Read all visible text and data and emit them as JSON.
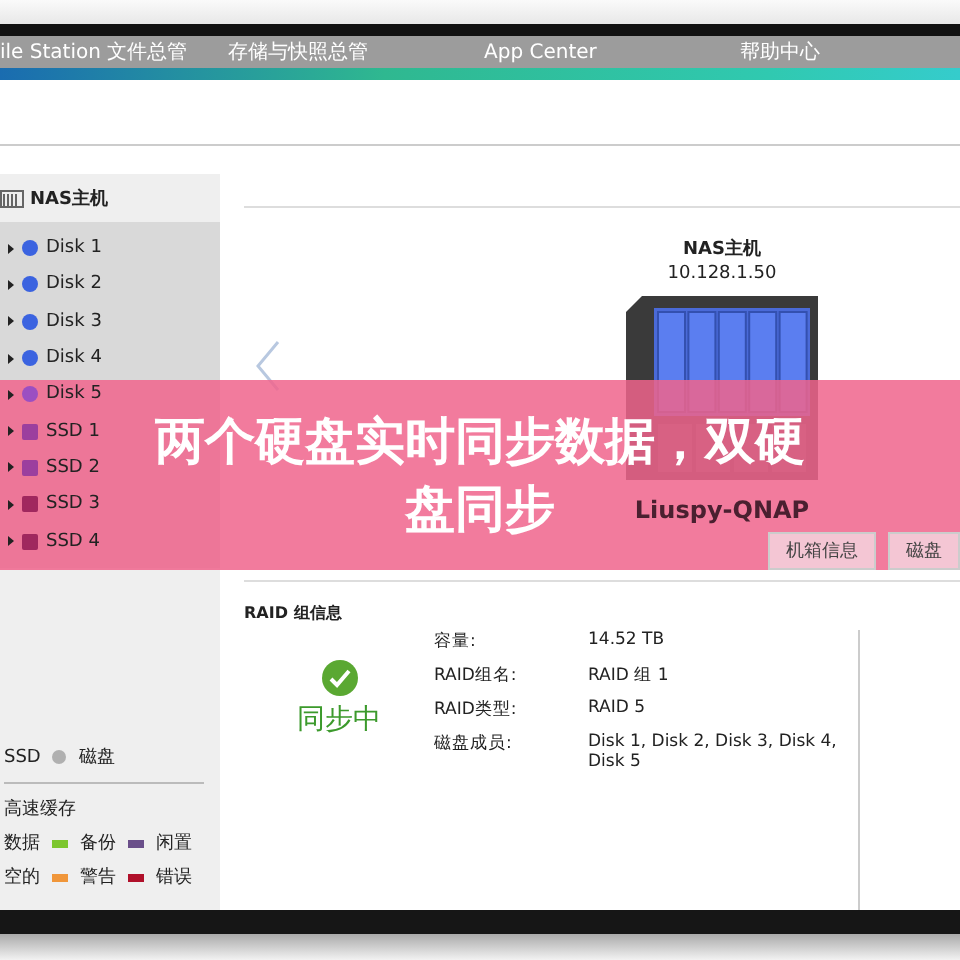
{
  "top_tabs": [
    "ile Station 文件总管",
    "存储与快照总管",
    "App Center",
    "帮助中心"
  ],
  "sidebar": {
    "root": "NAS主机",
    "items": [
      {
        "label": "Disk 1",
        "kind": "disk",
        "color": "#3b63e0"
      },
      {
        "label": "Disk 2",
        "kind": "disk",
        "color": "#3b63e0"
      },
      {
        "label": "Disk 3",
        "kind": "disk",
        "color": "#3b63e0"
      },
      {
        "label": "Disk 4",
        "kind": "disk",
        "color": "#3b63e0"
      },
      {
        "label": "Disk 5",
        "kind": "disk",
        "color": "#9b4fc2"
      },
      {
        "label": "SSD 1",
        "kind": "ssd",
        "color": "#9c3f9e"
      },
      {
        "label": "SSD 2",
        "kind": "ssd",
        "color": "#9c3f9e"
      },
      {
        "label": "SSD 3",
        "kind": "ssd",
        "color": "#a0285e"
      },
      {
        "label": "SSD 4",
        "kind": "ssd",
        "color": "#a0285e"
      }
    ],
    "type_legend": [
      {
        "label": "SSD"
      },
      {
        "label": "磁盘",
        "color": "#b0b0b0"
      }
    ],
    "status_title": "高速缓存",
    "status_legend": [
      [
        {
          "label": "数据"
        },
        {
          "label": "备份",
          "color": "#7cc62e"
        },
        {
          "label": "闲置",
          "color": "#6a4f8a"
        }
      ],
      [
        {
          "label": "空的"
        },
        {
          "label": "警告",
          "color": "#f0963a"
        },
        {
          "label": "错误",
          "color": "#b0102a"
        }
      ]
    ]
  },
  "device": {
    "name": "NAS主机",
    "ip": "10.128.1.50",
    "host": "Liuspy-QNAP",
    "buttons": [
      "机箱信息",
      "磁盘"
    ]
  },
  "raid": {
    "title": "RAID 组信息",
    "status": "同步中",
    "rows": [
      {
        "label": "容量:",
        "value": "14.52 TB"
      },
      {
        "label": "RAID组名:",
        "value": "RAID 组 1"
      },
      {
        "label": "RAID类型:",
        "value": "RAID 5"
      },
      {
        "label": "磁盘成员:",
        "value": "Disk 1, Disk 2, Disk 3, Disk 4, Disk 5"
      }
    ]
  },
  "banner": {
    "lines": [
      "两个硬盘实时同步数据，双硬",
      "盘同步"
    ]
  }
}
